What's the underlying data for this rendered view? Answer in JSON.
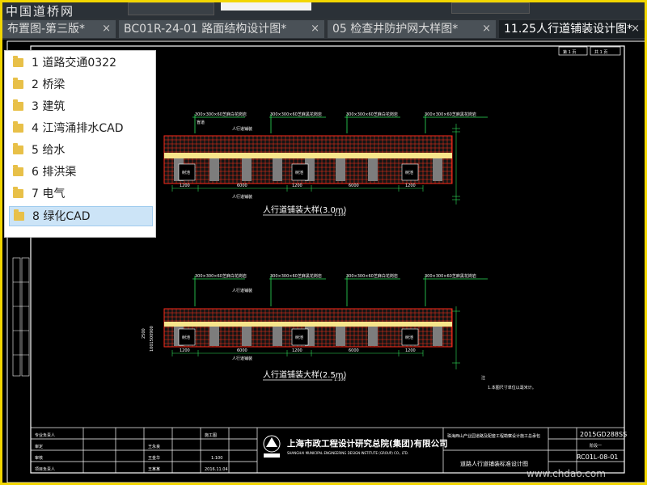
{
  "watermark": "中国道桥网",
  "tabs": [
    {
      "label": "布置图-第三版*",
      "close": "×"
    },
    {
      "label": "BC01R-24-01 路面结构设计图*",
      "close": "×"
    },
    {
      "label": "05 检查井防护网大样图*",
      "close": "×"
    },
    {
      "label": "11.25人行道铺装设计图*",
      "close": "×"
    }
  ],
  "folders": [
    {
      "label": "1 道路交通0322"
    },
    {
      "label": "2 桥梁"
    },
    {
      "label": "3 建筑"
    },
    {
      "label": "4 江湾涌排水CAD"
    },
    {
      "label": "5 给水"
    },
    {
      "label": "6 排洪渠"
    },
    {
      "label": "7 电气"
    },
    {
      "label": "8 绿化CAD"
    }
  ],
  "selected_folder": "8 绿化CAD",
  "drawing": {
    "sheet_no": "第 1 页",
    "sheet_total": "共 1 页",
    "plan_a": {
      "title": "人行道铺装大样(3.0m)",
      "scale": "1:100",
      "callouts": [
        "300×300×60芝麻白花岗岩",
        "300×300×60芝麻黑花岗岩",
        "300×300×60芝麻白花岗岩",
        "300×300×60芝麻黑花岗岩"
      ],
      "dims": [
        "1200",
        "6000",
        "1200",
        "6000",
        "1200"
      ],
      "tree": "树池",
      "side_dims": "1001500900",
      "sub_label": "人行道铺装",
      "curb_label": "盲道"
    },
    "plan_b": {
      "title": "人行道铺装大样(2.5m)",
      "scale": "1:100",
      "callouts": [
        "300×300×60芝麻白花岗岩",
        "300×300×60芝麻黑花岗岩",
        "300×300×60芝麻白花岗岩",
        "300×300×60芝麻黑花岗岩"
      ],
      "dims": [
        "1200",
        "6000",
        "1200",
        "6000",
        "1200"
      ],
      "tree": "树池",
      "side_dims": "1001500900",
      "side_dims_2": "2500",
      "sub_label": "人行道铺装"
    },
    "notes_title": "注",
    "note_1": "1.本图尺寸单位以毫米计。",
    "title_block": {
      "company": "上海市政工程设计研究总院(集团)有限公司",
      "company_en": "SHANGHAI MUNICIPAL ENGINEERING DESIGN INSTITUTE (GROUP) CO., LTD.",
      "project": "珠海西山产业园道路及配套工程勘察设计施工总承包",
      "drawing_title": "道路人行道铺装标准设计图",
      "project_no": "2015GD288SS",
      "stage": "施工图",
      "scale": "1:100",
      "date": "2016.11.04",
      "drawing_no": "RC01L-08-01",
      "phase": "阶段一",
      "roles": [
        "审定",
        "审核",
        "项目负责人",
        "专业负责人"
      ],
      "signers": [
        "王永良",
        "王金华",
        "王某某"
      ]
    }
  },
  "site_watermark": "www.chdao.com"
}
